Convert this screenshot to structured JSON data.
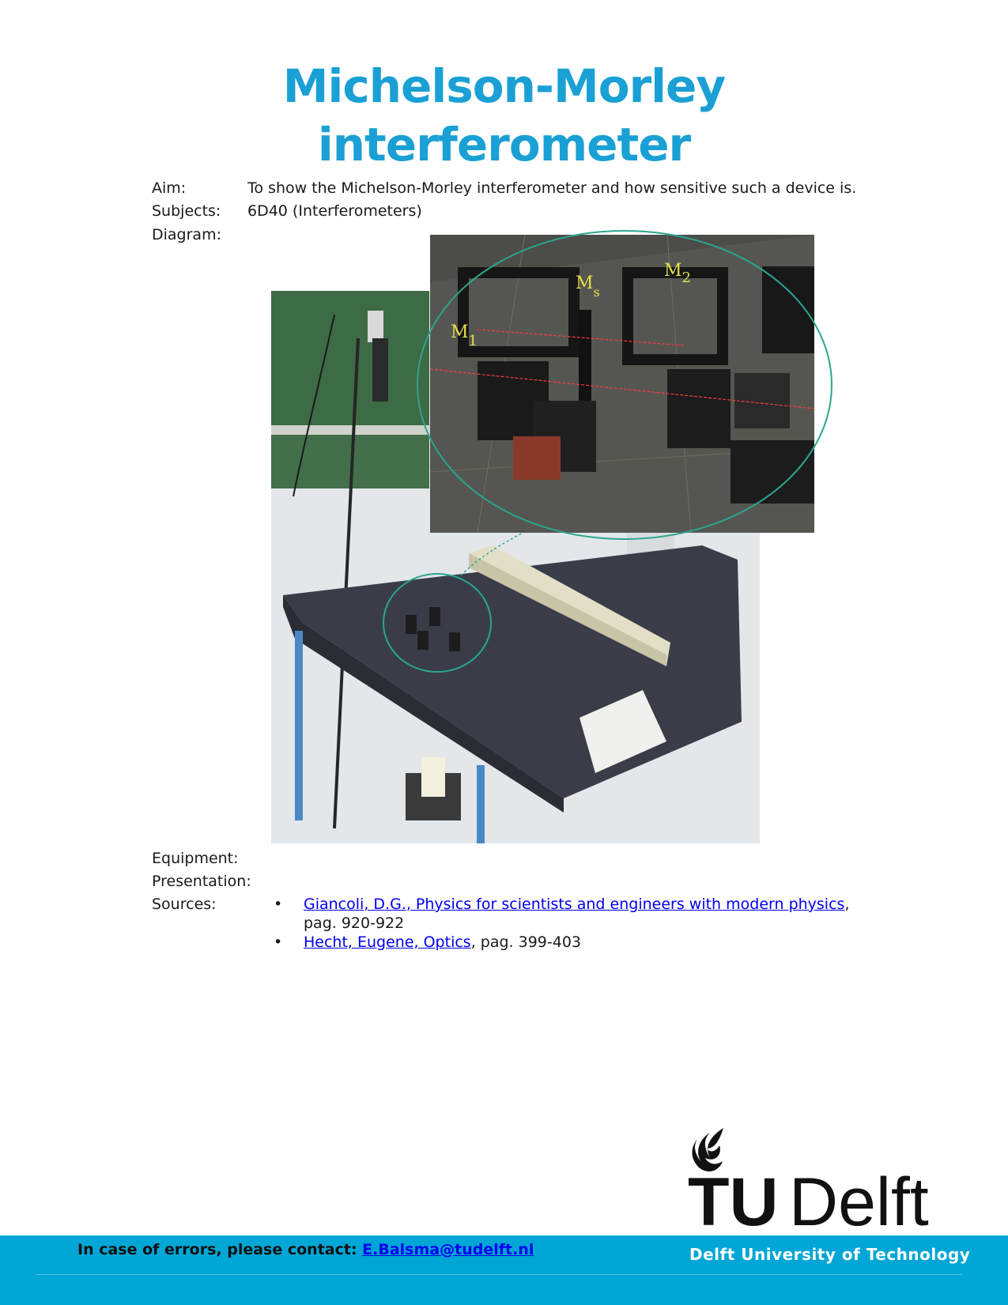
{
  "document": {
    "title_line1": "Michelson-Morley",
    "title_line2": "interferometer",
    "fields": {
      "aim_label": "Aim:",
      "aim_value": "To show the Michelson-Morley interferometer and how sensitive such a device is.",
      "subjects_label": "Subjects:",
      "subjects_value": "6D40 (Interferometers)",
      "diagram_label": "Diagram:",
      "equipment_label": "Equipment:",
      "presentation_label": "Presentation:",
      "sources_label": "Sources:"
    },
    "diagram_labels": {
      "m1": "M",
      "m1_sub": "1",
      "ms": "M",
      "ms_sub": "s",
      "m2": "M",
      "m2_sub": "2"
    },
    "sources": [
      {
        "bullet": "•",
        "link": "Giancoli, D.G., Physics for scientists and engineers with modern physics",
        "suffix": ", pag. 920-922"
      },
      {
        "bullet": "•",
        "link": "Hecht, Eugene, Optics",
        "suffix": ", pag. 399-403"
      }
    ]
  },
  "logo": {
    "text_tu": "TU",
    "text_delft": "Delft"
  },
  "footer": {
    "contact_label": "In case of errors, please contact: ",
    "contact_email": "E.Balsma@tudelft.nl",
    "university": "Delft University of Technology"
  },
  "colors": {
    "title": "#1aa0d4",
    "footer_bar": "#00a6d6",
    "link": "#0000ee"
  }
}
